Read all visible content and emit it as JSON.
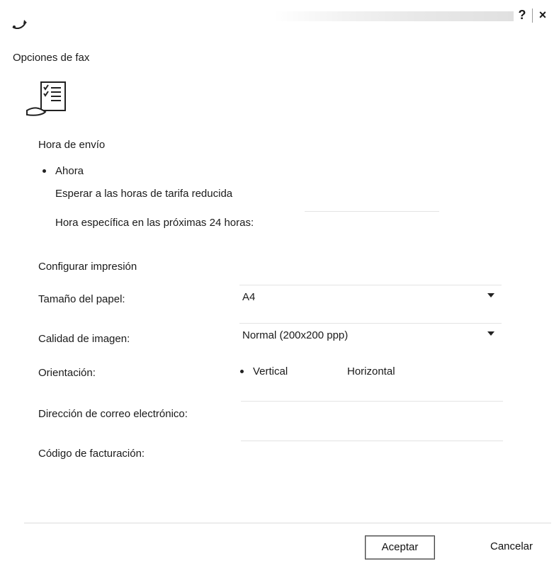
{
  "titlebar": {
    "help_label": "?",
    "close_label": "×"
  },
  "section_title": "Opciones de fax",
  "send_time": {
    "heading": "Hora de envío",
    "options": [
      {
        "label": "Ahora",
        "selected": true
      },
      {
        "label": "Esperar a las horas de tarifa reducida",
        "selected": false
      },
      {
        "label": "Hora específica en las próximas 24 horas:",
        "selected": false
      }
    ]
  },
  "print_config": {
    "heading": "Configurar impresión",
    "paper_size_label": "Tamaño del papel:",
    "paper_size_value": "A4",
    "image_quality_label": "Calidad de imagen:",
    "image_quality_value": "Normal (200x200 ppp)",
    "orientation_label": "Orientación:",
    "orientation_vertical": "Vertical",
    "orientation_horizontal": "Horizontal",
    "orientation_selected": "Vertical"
  },
  "email_label": "Dirección de correo electrónico:",
  "email_value": "",
  "billing_label": "Código de facturación:",
  "billing_value": "",
  "buttons": {
    "accept": "Aceptar",
    "cancel": "Cancelar"
  }
}
